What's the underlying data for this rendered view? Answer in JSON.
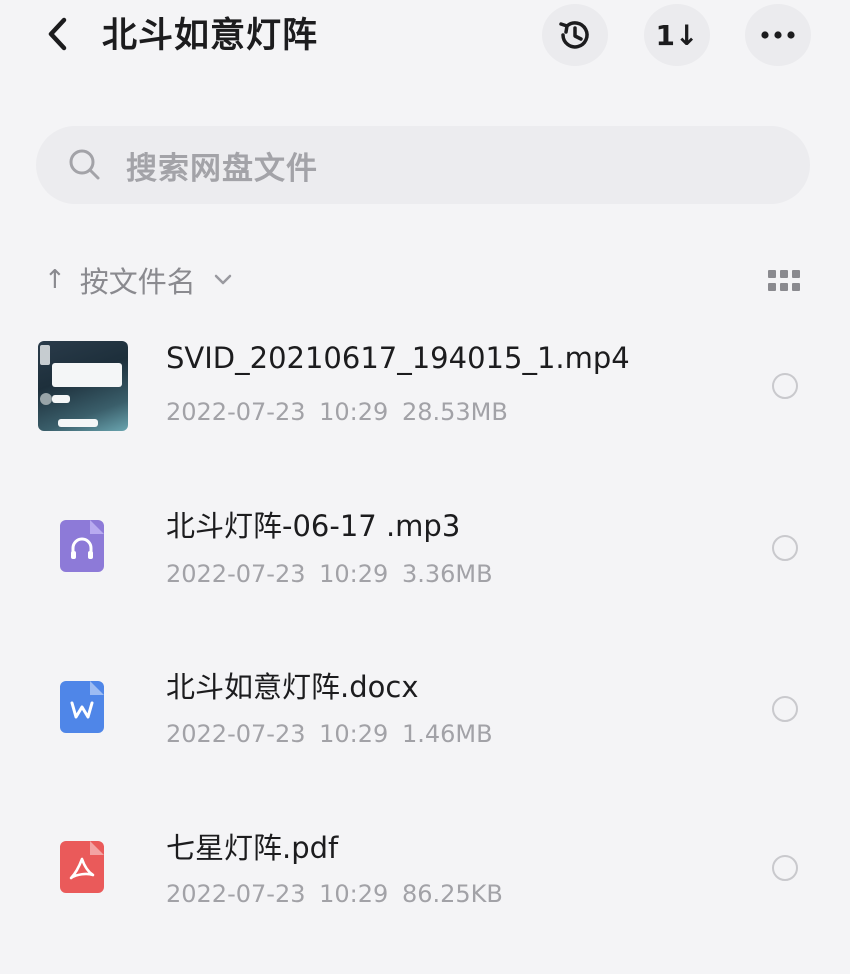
{
  "header": {
    "title": "北斗如意灯阵",
    "sort_glyph": "1↓"
  },
  "search": {
    "placeholder": "搜索网盘文件"
  },
  "sort": {
    "arrow": "↑",
    "label": "按文件名"
  },
  "files": [
    {
      "name": "SVID_20210617_194015_1.mp4",
      "date": "2022-07-23",
      "time": "10:29",
      "size": "28.53MB",
      "type": "video"
    },
    {
      "name": "北斗灯阵-06-17 .mp3",
      "date": "2022-07-23",
      "time": "10:29",
      "size": "3.36MB",
      "type": "audio"
    },
    {
      "name": "北斗如意灯阵.docx",
      "date": "2022-07-23",
      "time": "10:29",
      "size": "1.46MB",
      "type": "word"
    },
    {
      "name": "七星灯阵.pdf",
      "date": "2022-07-23",
      "time": "10:29",
      "size": "86.25KB",
      "type": "pdf"
    }
  ],
  "icons": {
    "back": "chevron-left-icon",
    "history": "history-icon",
    "sort": "sort-icon",
    "more": "more-icon",
    "search": "search-icon",
    "view": "grid-view-icon",
    "audio": "headphones-icon",
    "word": "word-icon",
    "pdf": "pdf-icon"
  },
  "colors": {
    "audio": "#8d7ad8",
    "word": "#4f86e8",
    "pdf": "#ea5a5a"
  }
}
